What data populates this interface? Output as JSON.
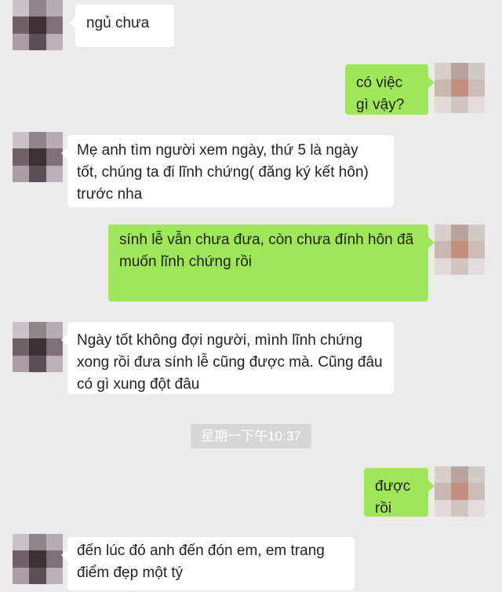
{
  "messages": [
    {
      "side": "in",
      "text": "ngủ chưa"
    },
    {
      "side": "out",
      "text": "có việc gì vậy?"
    },
    {
      "side": "in",
      "text": "Mẹ anh tìm người xem ngày, thứ 5 là ngày tốt, chúng ta đi lĩnh chứng( đăng ký kết hôn) trước nha"
    },
    {
      "side": "out",
      "text": "sính lễ vẫn chưa đưa, còn chưa đính hôn đã muốn lĩnh chứng rồi"
    },
    {
      "side": "in",
      "text": "Ngày tốt không đợi người, mình lĩnh chứng xong rồi đưa sính lễ cũng được mà. Cũng đâu có gì xung đột đâu"
    },
    {
      "side": "out",
      "text": "được rồi"
    },
    {
      "side": "in",
      "text": "đến lúc đó anh đến đón em, em trang điểm đẹp một tý"
    }
  ],
  "timestamp": "星期一下午10:37",
  "colors": {
    "background": "#ebebeb",
    "incoming_bubble": "#ffffff",
    "outgoing_bubble": "#9fe658",
    "timestamp_bg": "#d6d6d6"
  }
}
